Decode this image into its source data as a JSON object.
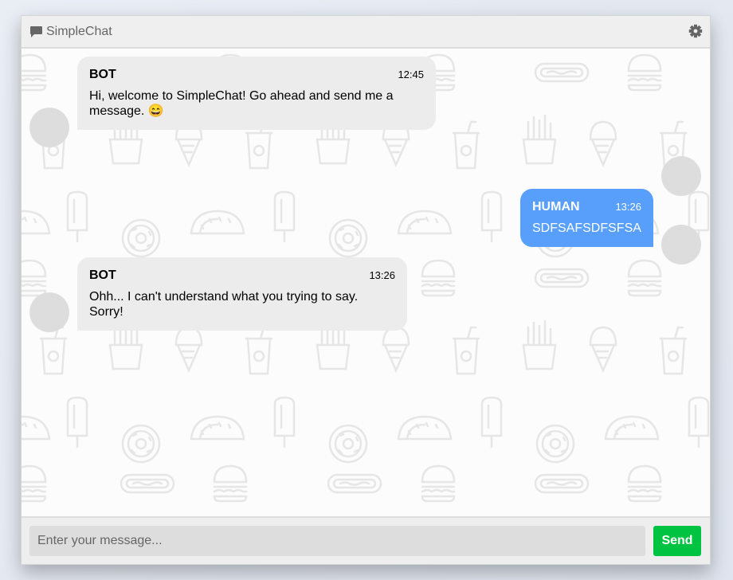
{
  "app": {
    "title": "SimpleChat",
    "icons": {
      "chat": "chat-bubble-icon",
      "settings": "gear-icon"
    }
  },
  "messages": [
    {
      "sender": "BOT",
      "time": "12:45",
      "text": "Hi, welcome to SimpleChat! Go ahead and send me a message. 😄",
      "side": "left"
    },
    {
      "sender": "HUMAN",
      "time": "13:26",
      "text": "SDFSAFSDFSFSA",
      "side": "right"
    },
    {
      "sender": "BOT",
      "time": "13:26",
      "text": "Ohh... I can't understand what you trying to say. Sorry!",
      "side": "left"
    }
  ],
  "composer": {
    "placeholder": "Enter your message...",
    "send_label": "Send"
  },
  "colors": {
    "bot_bubble": "#ececec",
    "human_bubble": "#579ffb",
    "send_button": "#00c441",
    "avatar": "#dddddd"
  }
}
